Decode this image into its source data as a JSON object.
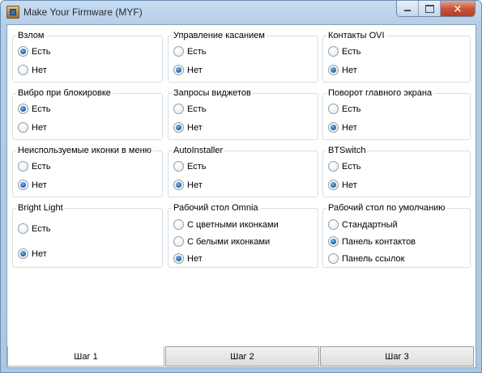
{
  "window": {
    "title": "Make Your Firmware (MYF)"
  },
  "groups": [
    {
      "title": "Взлом",
      "options": [
        {
          "label": "Есть",
          "checked": true
        },
        {
          "label": "Нет",
          "checked": false
        }
      ]
    },
    {
      "title": "Управление касанием",
      "options": [
        {
          "label": "Есть",
          "checked": false
        },
        {
          "label": "Нет",
          "checked": true
        }
      ]
    },
    {
      "title": "Контакты OVI",
      "options": [
        {
          "label": "Есть",
          "checked": false
        },
        {
          "label": "Нет",
          "checked": true
        }
      ]
    },
    {
      "title": "Вибро при блокировке",
      "options": [
        {
          "label": "Есть",
          "checked": true
        },
        {
          "label": "Нет",
          "checked": false
        }
      ]
    },
    {
      "title": "Запросы виджетов",
      "options": [
        {
          "label": "Есть",
          "checked": false
        },
        {
          "label": "Нет",
          "checked": true
        }
      ]
    },
    {
      "title": "Поворот главного экрана",
      "options": [
        {
          "label": "Есть",
          "checked": false
        },
        {
          "label": "Нет",
          "checked": true
        }
      ]
    },
    {
      "title": "Неиспользуемые иконки в меню",
      "options": [
        {
          "label": "Есть",
          "checked": false
        },
        {
          "label": "Нет",
          "checked": true
        }
      ]
    },
    {
      "title": "AutoInstaller",
      "options": [
        {
          "label": "Есть",
          "checked": false
        },
        {
          "label": "Нет",
          "checked": true
        }
      ]
    },
    {
      "title": "BTSwitch",
      "options": [
        {
          "label": "Есть",
          "checked": false
        },
        {
          "label": "Нет",
          "checked": true
        }
      ]
    },
    {
      "title": "Bright Light",
      "options": [
        {
          "label": "Есть",
          "checked": false
        },
        {
          "label": "Нет",
          "checked": true
        }
      ]
    },
    {
      "title": "Рабочий стол Omnia",
      "options": [
        {
          "label": "С цветными иконками",
          "checked": false
        },
        {
          "label": "С белыми иконками",
          "checked": false
        },
        {
          "label": "Нет",
          "checked": true
        }
      ]
    },
    {
      "title": "Рабочий стол по умолчанию",
      "options": [
        {
          "label": "Стандартный",
          "checked": false
        },
        {
          "label": "Панель контактов",
          "checked": true
        },
        {
          "label": "Панель ссылок",
          "checked": false
        }
      ]
    }
  ],
  "tabs": [
    {
      "label": "Шаг 1",
      "active": true
    },
    {
      "label": "Шаг 2",
      "active": false
    },
    {
      "label": "Шаг 3",
      "active": false
    }
  ]
}
